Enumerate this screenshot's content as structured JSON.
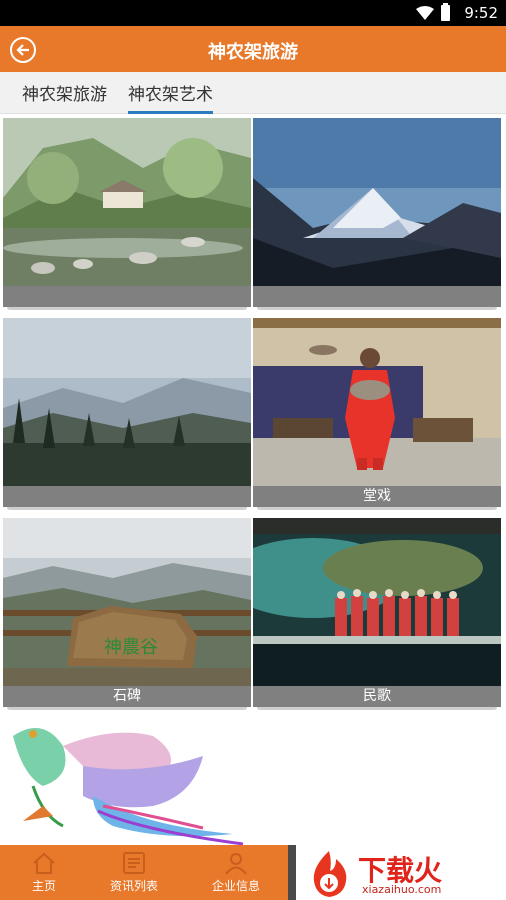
{
  "status_bar": {
    "time": "9:52"
  },
  "header": {
    "title": "神农架旅游"
  },
  "tabs": [
    {
      "label": "神农架旅游",
      "active": false
    },
    {
      "label": "神农架艺术",
      "active": true
    }
  ],
  "gallery": [
    {
      "caption": ""
    },
    {
      "caption": ""
    },
    {
      "caption": ""
    },
    {
      "caption": "堂戏"
    },
    {
      "caption": "石碑"
    },
    {
      "caption": "民歌"
    },
    {
      "caption": ""
    }
  ],
  "stone_inscription": "神農谷",
  "bottom_nav": [
    {
      "label": "主页",
      "icon": "home-icon"
    },
    {
      "label": "资讯列表",
      "icon": "news-list-icon"
    },
    {
      "label": "企业信息",
      "icon": "person-icon"
    }
  ],
  "watermark": {
    "text": "下载火",
    "url": "xiazaihuo.com"
  },
  "colors": {
    "accent": "#e8782a",
    "tab_indicator": "#2b7bbf",
    "caption_bg": "#808080"
  }
}
